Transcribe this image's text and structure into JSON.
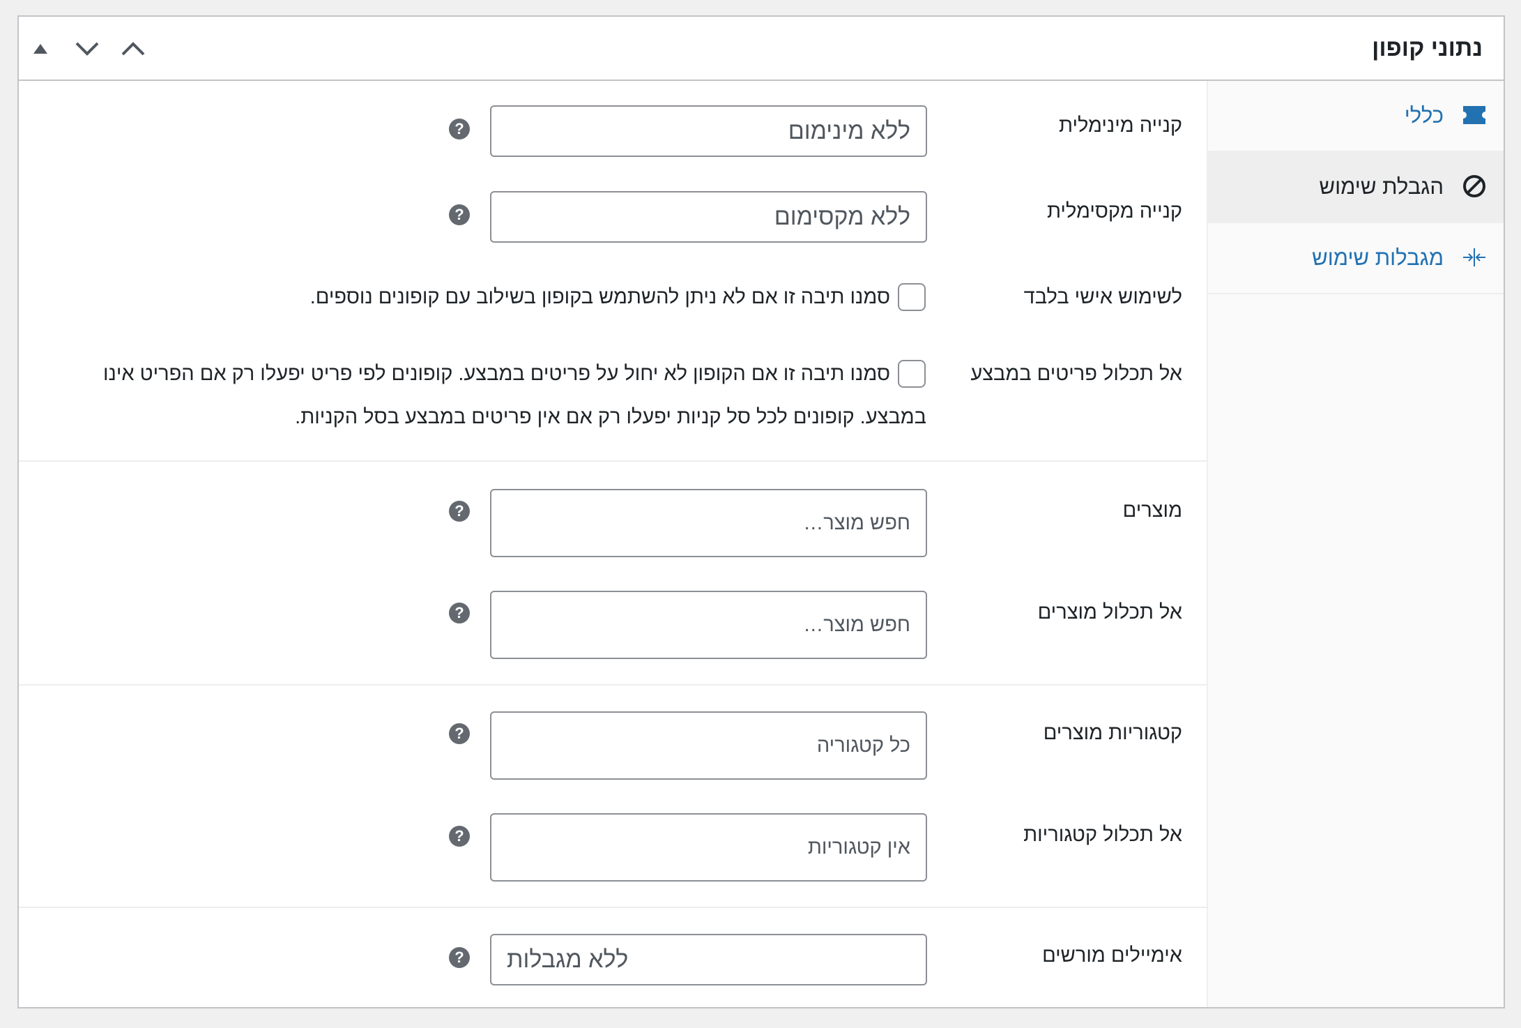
{
  "panel": {
    "title": "נתוני קופון",
    "controls": [
      "move-up",
      "move-down",
      "toggle-panel"
    ]
  },
  "tabs": [
    {
      "label": "כללי",
      "icon": "ticket-icon",
      "active": false
    },
    {
      "label": "הגבלת שימוש",
      "icon": "prohibited-icon",
      "active": true
    },
    {
      "label": "מגבלות שימוש",
      "icon": "limits-arrows-icon",
      "active": false
    }
  ],
  "restrictions": {
    "min_spend": {
      "label": "קנייה מינימלית",
      "placeholder": "ללא מינימום"
    },
    "max_spend": {
      "label": "קנייה מקסימלית",
      "placeholder": "ללא מקסימום"
    },
    "individual_use": {
      "label": "לשימוש אישי בלבד",
      "description": "סמנו תיבה זו אם לא ניתן להשתמש בקופון בשילוב עם קופונים נוספים.",
      "checked": false
    },
    "exclude_sale": {
      "label": "אל תכלול פריטים במבצע",
      "description_line1": "סמנו תיבה זו אם הקופון לא יחול על פריטים במבצע. קופונים לפי פריט יפעלו רק אם הפריט אינו",
      "description_line2": "במבצע. קופונים לכל סל קניות יפעלו רק אם אין פריטים במבצע בסל הקניות.",
      "checked": false
    },
    "products": {
      "label": "מוצרים",
      "placeholder": "חפש מוצר…"
    },
    "exclude_products": {
      "label": "אל תכלול מוצרים",
      "placeholder": "חפש מוצר…"
    },
    "categories": {
      "label": "קטגוריות מוצרים",
      "placeholder": "כל קטגוריה"
    },
    "exclude_categories": {
      "label": "אל תכלול קטגוריות",
      "placeholder": "אין קטגוריות"
    },
    "allowed_emails": {
      "label": "אימיילים מורשים",
      "placeholder": "ללא מגבלות"
    }
  },
  "help_glyph": "?",
  "colors": {
    "accent": "#2271b1",
    "text": "#1d2327",
    "border": "#c3c4c7",
    "help_icon": "#646970"
  }
}
